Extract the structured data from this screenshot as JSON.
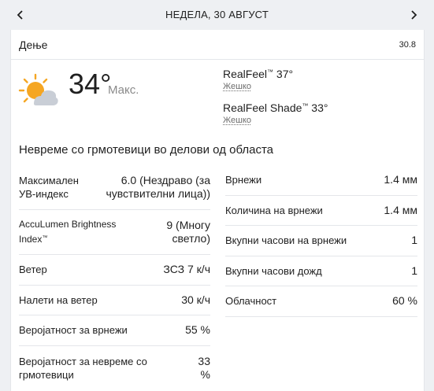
{
  "nav": {
    "title": "НЕДЕЛА, 30 АВГУСТ",
    "prev_icon": "chevron-left-icon",
    "next_icon": "chevron-right-icon"
  },
  "card": {
    "period_label": "Дење",
    "date": "30.8"
  },
  "hero": {
    "icon": "partly-sunny-icon",
    "temperature": "34°",
    "temperature_label": "Макс.",
    "realfeel_name": "RealFeel",
    "realfeel_value": "37°",
    "realfeel_desc": "Жешко",
    "realfeel_shade_name": "RealFeel Shade",
    "realfeel_shade_value": "33°",
    "realfeel_shade_desc": "Жешко",
    "trademark": "™"
  },
  "phrase": "Невреме со грмотевици во делови од областа",
  "details_left": [
    {
      "label_line1": "Максимален",
      "label_line2": "УВ-индекс",
      "value_line1": "6.0 (Нездраво (за",
      "value_line2": "чувствителни лица))"
    },
    {
      "label_line1": "AccuLumen Brightness",
      "label_line2": "Index",
      "value_line1": "9 (Многу",
      "value_line2": "светло)"
    },
    {
      "label": "Ветер",
      "value": "ЗСЗ 7 к/ч"
    },
    {
      "label": "Налети на ветер",
      "value": "30 к/ч"
    },
    {
      "label": "Веројатност за врнежи",
      "value": "55 %"
    },
    {
      "label_line1": "Веројатност за невреме со",
      "label_line2": "грмотевици",
      "value_line1": "33",
      "value_line2": "%"
    }
  ],
  "details_right": [
    {
      "label": "Врнежи",
      "value": "1.4 мм"
    },
    {
      "label": "Количина на врнежи",
      "value": "1.4 мм"
    },
    {
      "label": "Вкупни часови на врнежи",
      "value": "1"
    },
    {
      "label": "Вкупни часови дожд",
      "value": "1"
    },
    {
      "label": "Облачност",
      "value": "60 %"
    }
  ],
  "colors": {
    "background": "#eef0f3",
    "card": "#ffffff",
    "divider": "#e4e6ea",
    "sun": "#f5a623",
    "cloud": "#c9ced6"
  }
}
